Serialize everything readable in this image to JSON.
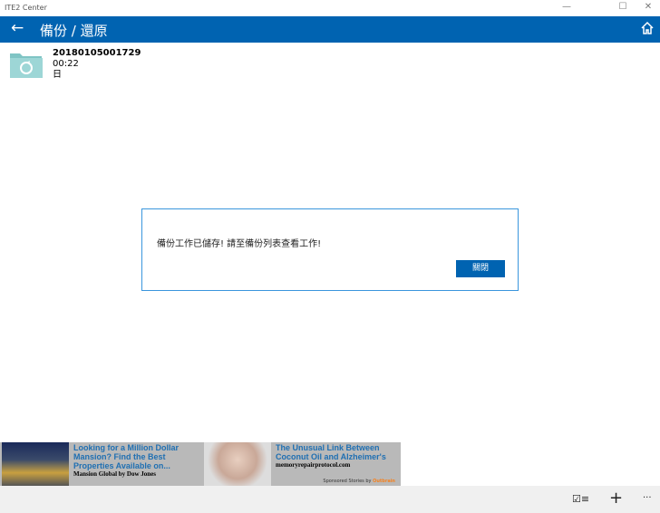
{
  "window": {
    "title": "ITE2 Center",
    "minimize": "—",
    "maximize": "☐",
    "close": "✕"
  },
  "header": {
    "back": "←",
    "title": "備份 / 還原"
  },
  "item": {
    "name": "20180105001729",
    "time": "00:22",
    "day": "日"
  },
  "dialog": {
    "message": "備份工作已儲存! 請至備份列表查看工作!",
    "close_label": "關閉"
  },
  "ads": [
    {
      "title": "Looking for a Million Dollar Mansion? Find the Best Properties Available on...",
      "source": "Mansion Global by Dow Jones"
    },
    {
      "title": "The Unusual Link Between Coconut Oil and Alzheimer's",
      "source": "memoryrepairprotocol.com"
    }
  ],
  "sponsor": {
    "prefix": "Sponsored Stories by",
    "brand": "Outbrain"
  },
  "bottom": {
    "select": "☑≡",
    "add": "+",
    "more": "···"
  },
  "colors": {
    "accent": "#0063b1"
  }
}
